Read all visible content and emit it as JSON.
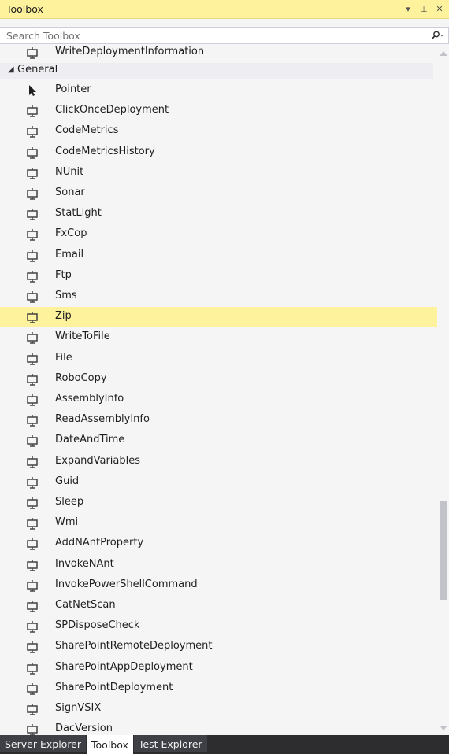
{
  "window": {
    "title": "Toolbox",
    "controls": {
      "dropdown": "▾",
      "pin": "⊥",
      "close": "✕"
    }
  },
  "search": {
    "placeholder": "Search Toolbox",
    "value": ""
  },
  "top_item": {
    "label": "WriteDeploymentInformation",
    "icon": "component-icon"
  },
  "group": {
    "label": "General",
    "expanded": true
  },
  "items": [
    {
      "label": "Pointer",
      "icon": "pointer-icon",
      "selected": false
    },
    {
      "label": "ClickOnceDeployment",
      "icon": "component-icon",
      "selected": false
    },
    {
      "label": "CodeMetrics",
      "icon": "component-icon",
      "selected": false
    },
    {
      "label": "CodeMetricsHistory",
      "icon": "component-icon",
      "selected": false
    },
    {
      "label": "NUnit",
      "icon": "component-icon",
      "selected": false
    },
    {
      "label": "Sonar",
      "icon": "component-icon",
      "selected": false
    },
    {
      "label": "StatLight",
      "icon": "component-icon",
      "selected": false
    },
    {
      "label": "FxCop",
      "icon": "component-icon",
      "selected": false
    },
    {
      "label": "Email",
      "icon": "component-icon",
      "selected": false
    },
    {
      "label": "Ftp",
      "icon": "component-icon",
      "selected": false
    },
    {
      "label": "Sms",
      "icon": "component-icon",
      "selected": false
    },
    {
      "label": "Zip",
      "icon": "component-icon",
      "selected": true
    },
    {
      "label": "WriteToFile",
      "icon": "component-icon",
      "selected": false
    },
    {
      "label": "File",
      "icon": "component-icon",
      "selected": false
    },
    {
      "label": "RoboCopy",
      "icon": "component-icon",
      "selected": false
    },
    {
      "label": "AssemblyInfo",
      "icon": "component-icon",
      "selected": false
    },
    {
      "label": "ReadAssemblyInfo",
      "icon": "component-icon",
      "selected": false
    },
    {
      "label": "DateAndTime",
      "icon": "component-icon",
      "selected": false
    },
    {
      "label": "ExpandVariables",
      "icon": "component-icon",
      "selected": false
    },
    {
      "label": "Guid",
      "icon": "component-icon",
      "selected": false
    },
    {
      "label": "Sleep",
      "icon": "component-icon",
      "selected": false
    },
    {
      "label": "Wmi",
      "icon": "component-icon",
      "selected": false
    },
    {
      "label": "AddNAntProperty",
      "icon": "component-icon",
      "selected": false
    },
    {
      "label": "InvokeNAnt",
      "icon": "component-icon",
      "selected": false
    },
    {
      "label": "InvokePowerShellCommand",
      "icon": "component-icon",
      "selected": false
    },
    {
      "label": "CatNetScan",
      "icon": "component-icon",
      "selected": false
    },
    {
      "label": "SPDisposeCheck",
      "icon": "component-icon",
      "selected": false
    },
    {
      "label": "SharePointRemoteDeployment",
      "icon": "component-icon",
      "selected": false
    },
    {
      "label": "SharePointAppDeployment",
      "icon": "component-icon",
      "selected": false
    },
    {
      "label": "SharePointDeployment",
      "icon": "component-icon",
      "selected": false
    },
    {
      "label": "SignVSIX",
      "icon": "component-icon",
      "selected": false
    },
    {
      "label": "DacVersion",
      "icon": "component-icon",
      "selected": false
    }
  ],
  "tabs": [
    {
      "label": "Server Explorer",
      "active": false
    },
    {
      "label": "Toolbox",
      "active": true
    },
    {
      "label": "Test Explorer",
      "active": false
    }
  ],
  "colors": {
    "title_bg": "#fff29d",
    "selected_bg": "#fff29d",
    "panel_bg": "#f5f5f5",
    "tabstrip_bg": "#2d2d30",
    "icon": "#424242"
  }
}
